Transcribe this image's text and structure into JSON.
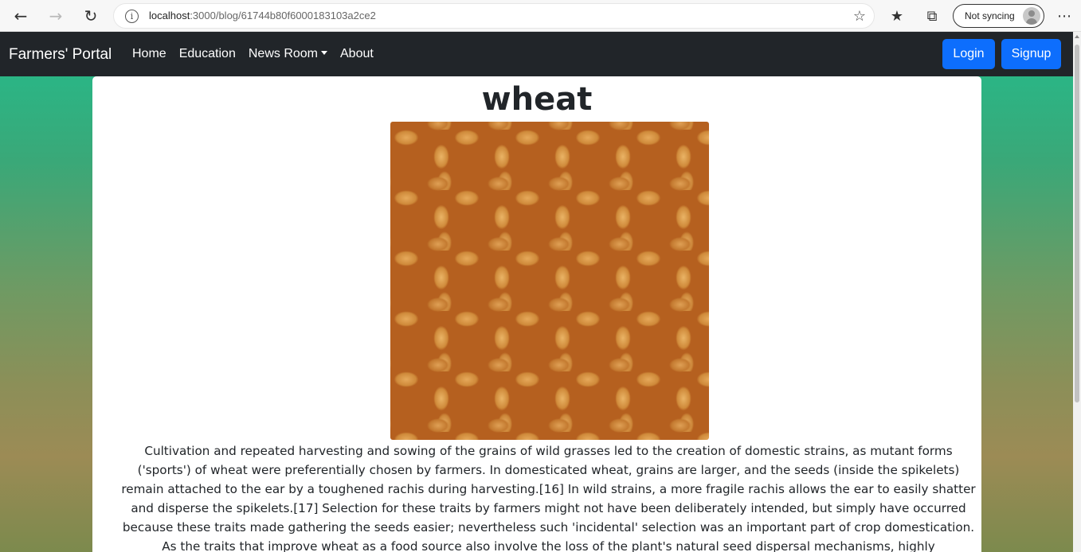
{
  "browser": {
    "url_host": "localhost",
    "url_rest": ":3000/blog/61744b80f6000183103a2ce2",
    "sync_label": "Not syncing",
    "icons": [
      "back-arrow-icon",
      "forward-arrow-icon",
      "refresh-icon",
      "info-icon",
      "add-favorite-icon",
      "favorites-icon",
      "collections-icon",
      "profile-icon",
      "more-icon"
    ]
  },
  "navbar": {
    "brand": "Farmers' Portal",
    "links": [
      "Home",
      "Education",
      "News Room",
      "About"
    ],
    "login_label": "Login",
    "signup_label": "Signup",
    "accent_color": "#0d6efd"
  },
  "post": {
    "title": "wheat",
    "image_subject": "wheat grains",
    "body": "Cultivation and repeated harvesting and sowing of the grains of wild grasses led to the creation of domestic strains, as mutant forms ('sports') of wheat were preferentially chosen by farmers. In domesticated wheat, grains are larger, and the seeds (inside the spikelets) remain attached to the ear by a toughened rachis during harvesting.[16] In wild strains, a more fragile rachis allows the ear to easily shatter and disperse the spikelets.[17] Selection for these traits by farmers might not have been deliberately intended, but simply have occurred because these traits made gathering the seeds easier; nevertheless such 'incidental' selection was an important part of crop domestication. As the traits that improve wheat as a food source also involve the loss of the plant's natural seed dispersal mechanisms, highly domesticated strains of wheat cannot survive in the wild. Archaeological analysis of wild"
  }
}
